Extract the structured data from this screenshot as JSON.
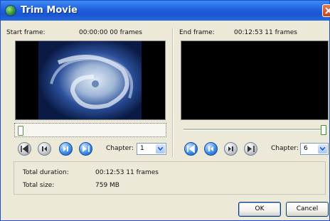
{
  "window": {
    "title": "Trim Movie"
  },
  "start": {
    "label": "Start frame:",
    "value": "00:00:00 00 frames",
    "chapter_label": "Chapter:",
    "chapter_value": "1"
  },
  "end": {
    "label": "End frame:",
    "value": "00:12:53 11 frames",
    "chapter_label": "Chapter:",
    "chapter_value": "6"
  },
  "start_slider_position": 0.0,
  "end_slider_position": 1.0,
  "info": {
    "duration_label": "Total duration:",
    "duration_value": "00:12:53 11 frames",
    "size_label": "Total size:",
    "size_value": "759 MB"
  },
  "buttons": {
    "ok": "OK",
    "cancel": "Cancel"
  },
  "icons": {
    "start_controls": [
      "skip-back-icon",
      "step-back-icon",
      "step-forward-icon",
      "skip-forward-icon"
    ],
    "end_controls": [
      "skip-back-icon",
      "step-back-icon",
      "step-forward-icon",
      "skip-forward-icon"
    ]
  }
}
